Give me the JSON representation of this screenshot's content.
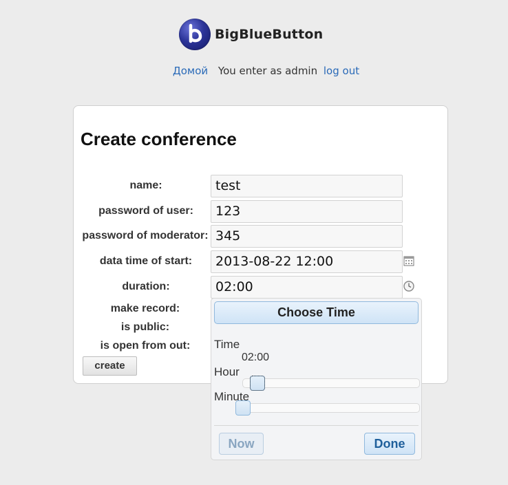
{
  "brand": {
    "name": "BigBlueButton"
  },
  "topbar": {
    "home_link": "Домой",
    "user_text": "You enter as admin",
    "logout_link": "log out"
  },
  "form": {
    "title": "Create conference",
    "fields": {
      "name": {
        "label": "name:",
        "value": "test"
      },
      "user_password": {
        "label": "password of user:",
        "value": "123"
      },
      "moderator_password": {
        "label": "password of moderator:",
        "value": "345"
      },
      "start": {
        "label": "data time of start:",
        "value": "2013-08-22 12:00"
      },
      "duration": {
        "label": "duration:",
        "value": "02:00"
      },
      "make_record": {
        "label": "make record:"
      },
      "is_public": {
        "label": "is public:"
      },
      "open_from_out": {
        "label": "is open from out:"
      }
    },
    "create_button": "create"
  },
  "time_picker": {
    "title": "Choose Time",
    "time_label": "Time",
    "time_value": "02:00",
    "hour_label": "Hour",
    "minute_label": "Minute",
    "hour_value": 2,
    "minute_value": 0,
    "now_button": "Now",
    "done_button": "Done"
  },
  "icons": {
    "calendar": "calendar-icon",
    "clock": "clock-icon"
  },
  "colors": {
    "link": "#2a6ab8",
    "accent": "#8fb8dd",
    "brand": "#2c3499"
  }
}
